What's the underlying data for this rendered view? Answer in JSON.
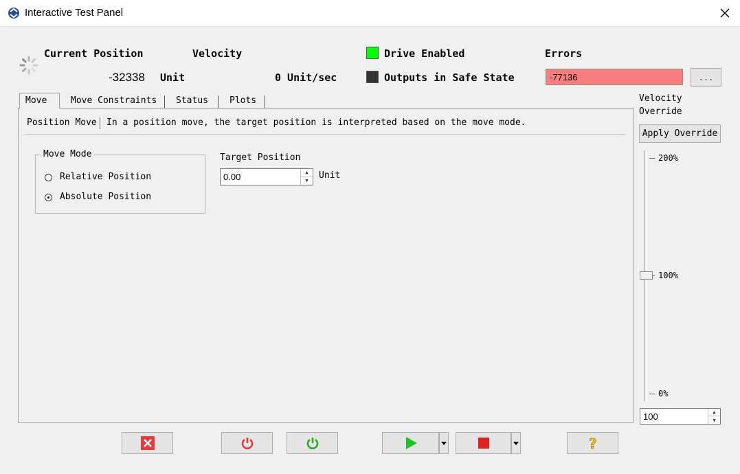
{
  "window": {
    "title": "Interactive Test Panel"
  },
  "header": {
    "current_position_label": "Current Position",
    "current_position_value": "-32338",
    "current_position_unit": "Unit",
    "velocity_label": "Velocity",
    "velocity_value": "0 Unit/sec",
    "drive_enabled_label": "Drive Enabled",
    "drive_enabled_color": "#00ff00",
    "outputs_safe_label": "Outputs in Safe State",
    "outputs_safe_color": "#333333",
    "errors_label": "Errors",
    "errors_value": "-77136",
    "errors_button": "..."
  },
  "tabs": [
    {
      "label": "Move",
      "active": true
    },
    {
      "label": "Move Constraints",
      "active": false
    },
    {
      "label": "Status",
      "active": false
    },
    {
      "label": "Plots",
      "active": false
    }
  ],
  "move_tab": {
    "description_title": "Position Move",
    "description_text": "In a position move, the target position is interpreted based on the move mode.",
    "move_mode": {
      "title": "Move Mode",
      "options": [
        "Relative Position",
        "Absolute Position"
      ],
      "selected": "Absolute Position"
    },
    "target_position": {
      "label": "Target Position",
      "value": "0.00",
      "unit": "Unit"
    }
  },
  "velocity_override": {
    "label": "Velocity Override",
    "apply_button": "Apply Override",
    "scale_top": "200%",
    "scale_mid": "100%",
    "scale_bottom": "0%",
    "value": "100"
  },
  "toolbar": {
    "buttons": [
      "clear-faults",
      "disable-drive",
      "enable-drive",
      "start-move",
      "stop-move",
      "help"
    ]
  }
}
